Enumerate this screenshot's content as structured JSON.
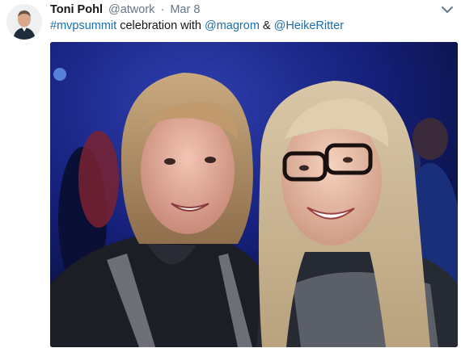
{
  "tweet": {
    "author_name": "Toni Pohl",
    "author_handle": "@atwork",
    "separator": "·",
    "date": "Mar 8",
    "text": {
      "hashtag": "#mvpsummit",
      "middle": " celebration with ",
      "mention1": "@magrom",
      "joiner": " & ",
      "mention2": "@HeikeRitter"
    }
  },
  "icons": {
    "caret": "chevron-down-icon"
  },
  "colors": {
    "link": "#1b6fab",
    "secondary_text": "#657786",
    "primary_text": "#14171a"
  }
}
